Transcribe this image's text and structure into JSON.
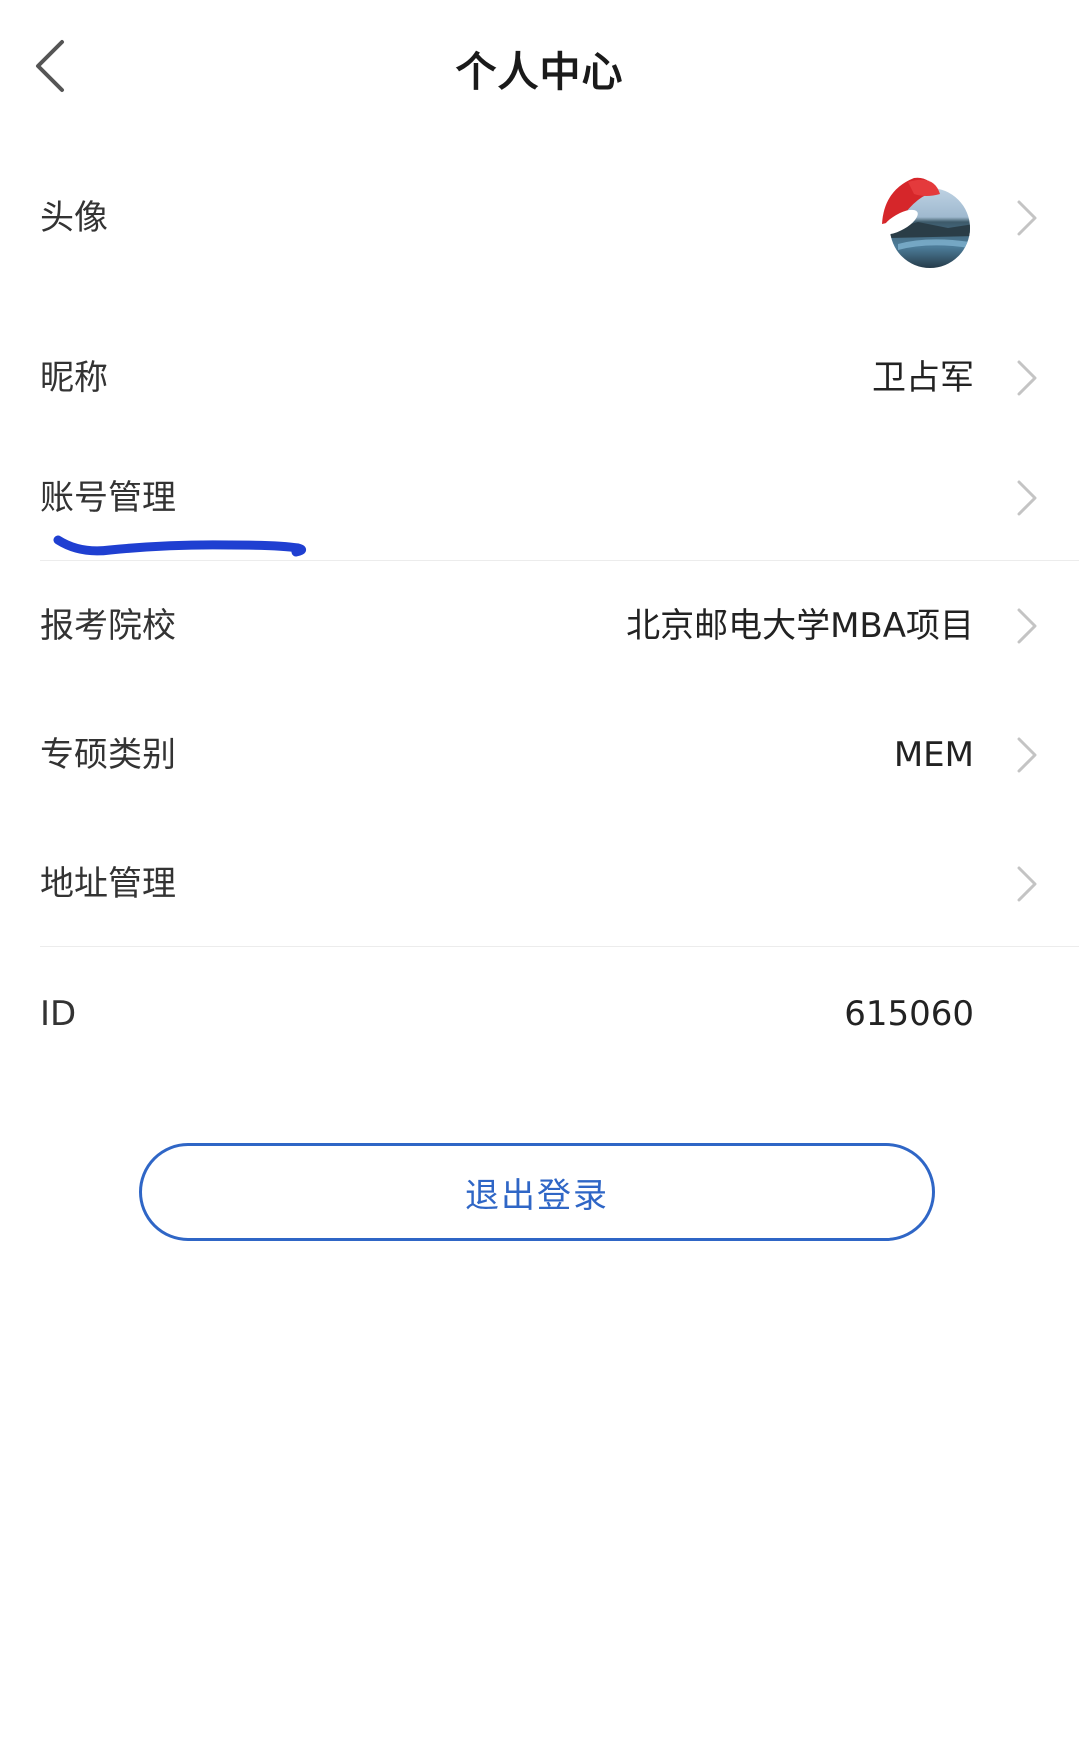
{
  "header": {
    "title": "个人中心",
    "back_icon": "chevron-left-icon"
  },
  "rows": [
    {
      "label": "头像",
      "value": "",
      "has_chevron": true
    },
    {
      "label": "昵称",
      "value": "卫占军",
      "has_chevron": true
    },
    {
      "label": "账号管理",
      "value": "",
      "has_chevron": true
    },
    {
      "label": "报考院校",
      "value": "北京邮电大学MBA项目",
      "has_chevron": true
    },
    {
      "label": "专硕类别",
      "value": "MEM",
      "has_chevron": true
    },
    {
      "label": "地址管理",
      "value": "",
      "has_chevron": true
    },
    {
      "label": "ID",
      "value": "615060",
      "has_chevron": false
    }
  ],
  "logout": {
    "label": "退出登录"
  },
  "colors": {
    "accent": "#2f66c6",
    "underline_mark": "#1f3fd1",
    "text": "#333333",
    "chevron": "#c4c4c4",
    "divider": "#ececec"
  },
  "icons": {
    "chevron": "chevron-right-icon",
    "avatar": "avatar-image-santa-hat"
  }
}
